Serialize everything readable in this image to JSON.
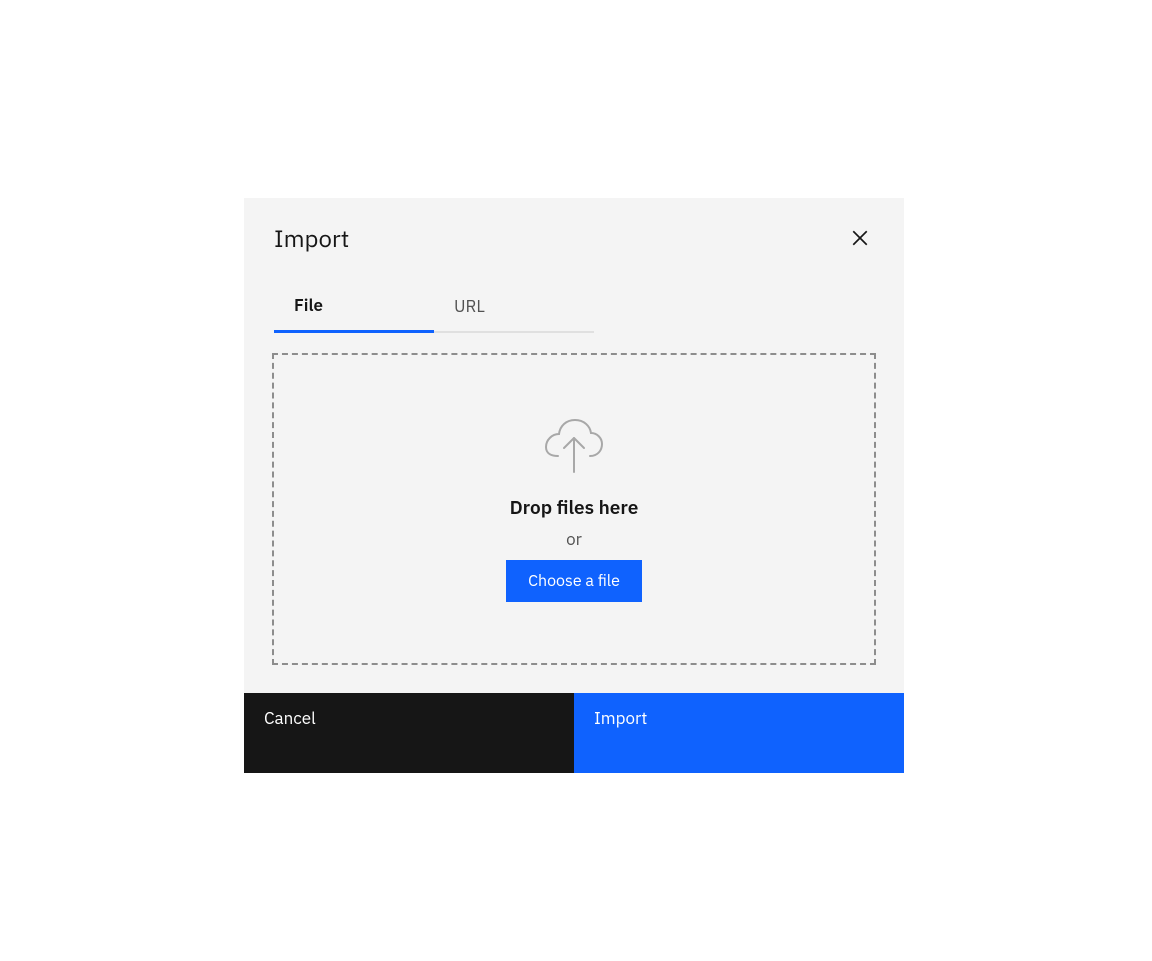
{
  "modal": {
    "title": "Import",
    "tabs": [
      {
        "label": "File",
        "active": true
      },
      {
        "label": "URL",
        "active": false
      }
    ],
    "dropzone": {
      "primary": "Drop files here",
      "separator": "or",
      "button": "Choose a file"
    },
    "footer": {
      "cancel": "Cancel",
      "confirm": "Import"
    }
  }
}
